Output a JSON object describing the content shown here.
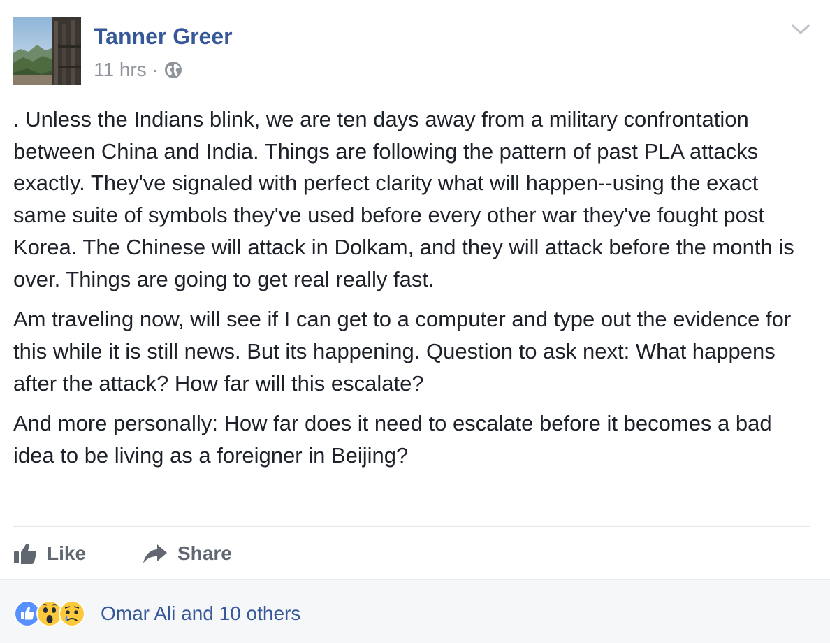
{
  "post": {
    "author": "Tanner Greer",
    "timestamp": "11 hrs",
    "separator": "·",
    "audience_icon": "globe-icon",
    "menu_icon": "chevron-down-icon",
    "paragraphs": [
      ". Unless the Indians blink, we are ten days away from a military confrontation between China and India. Things are following the pattern of past PLA attacks exactly. They've signaled with perfect clarity what will happen--using the exact same suite of symbols they've used before every other war they've fought post Korea. The Chinese will attack in Dolkam, and they will attack before the month is over. Things are going to get real really fast.",
      "Am traveling now, will see if I can get to a computer and type out the evidence for this while it is still news. But its happening. Question to ask next: What happens after the attack? How far will this escalate?",
      "And more personally: How far does it need to escalate before it becomes a bad idea to be living as a foreigner in Beijing?"
    ]
  },
  "actions": {
    "like_label": "Like",
    "like_icon": "thumbs-up-icon",
    "share_label": "Share",
    "share_icon": "share-arrow-icon"
  },
  "reactions": {
    "icons": [
      "like-reaction-icon",
      "wow-reaction-icon",
      "sad-reaction-icon"
    ],
    "summary": "Omar Ali and 10 others"
  },
  "colors": {
    "author_link": "#365899",
    "body_text": "#1d2129",
    "meta_text": "#90949c",
    "action_text": "#616770",
    "like_blue": "#5890ff",
    "reaction_yellow": "#fcc93d",
    "footer_bg": "#f6f7f9"
  }
}
